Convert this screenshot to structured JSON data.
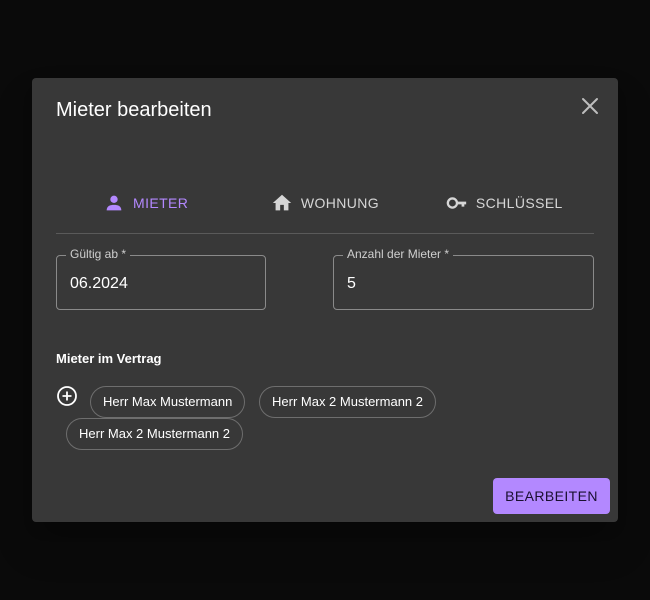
{
  "dialog": {
    "title": "Mieter bearbeiten",
    "close_icon": "close-icon"
  },
  "tabs": [
    {
      "label": "MIETER",
      "icon": "person-icon",
      "active": true
    },
    {
      "label": "WOHNUNG",
      "icon": "home-icon",
      "active": false
    },
    {
      "label": "SCHLÜSSEL",
      "icon": "key-icon",
      "active": false
    }
  ],
  "form": {
    "valid_from": {
      "label": "Gültig ab *",
      "value": "06.2024"
    },
    "tenant_count": {
      "label": "Anzahl der Mieter *",
      "value": "5"
    }
  },
  "tenants_section": {
    "title": "Mieter im Vertrag",
    "add_icon": "add-circle-icon",
    "chips": [
      "Herr Max Mustermann",
      "Herr Max 2 Mustermann 2",
      "Herr Max 2 Mustermann 2"
    ]
  },
  "actions": {
    "edit_label": "BEARBEITEN"
  },
  "colors": {
    "accent": "#b388ff",
    "dialog_bg": "#383838",
    "backdrop": "#0a0a0a"
  }
}
